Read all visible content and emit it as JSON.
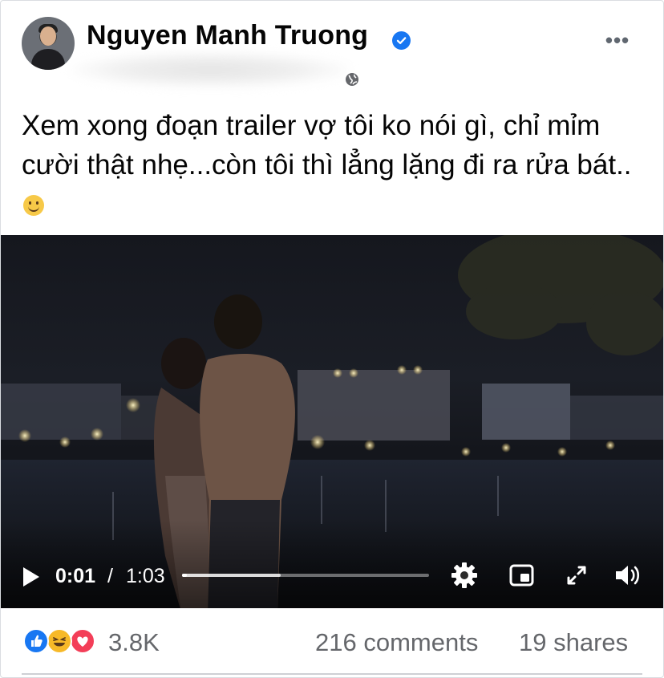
{
  "post": {
    "author": "Nguyen Manh Truong",
    "text": "Xem xong đoạn trailer vợ tôi ko nói gì, chỉ mỉm cười thật nhẹ...còn tôi thì lẳng lặng đi ra rửa bát.."
  },
  "icons": {
    "verified": "verified-badge-icon",
    "audience": "globe-icon",
    "more": "more-options-icon",
    "emoji": "smiling-face-emoji"
  },
  "video": {
    "current_time": "0:01",
    "separator": "/",
    "duration": "1:03",
    "progress": 0.02,
    "buffered": 0.4
  },
  "stats": {
    "reactions_count": "3.8K",
    "comments": "216 comments",
    "shares": "19 shares",
    "reaction_types": [
      "like",
      "haha",
      "love"
    ]
  },
  "colors": {
    "verified": "#1877f2",
    "like": "#1877f2",
    "haha": "#f7b928",
    "love": "#f33e58",
    "secondary_text": "#65676b"
  }
}
